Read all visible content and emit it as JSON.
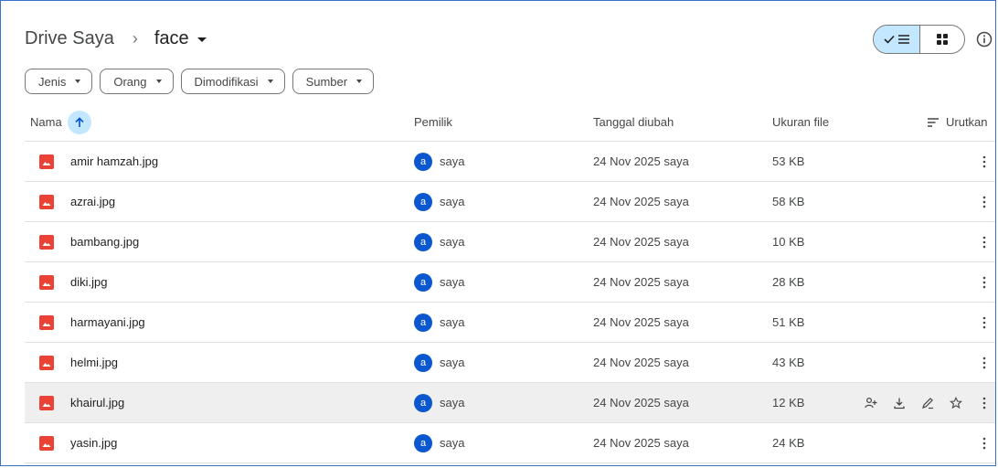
{
  "breadcrumb": {
    "root": "Drive Saya",
    "separator": "›",
    "current": "face"
  },
  "filters": [
    "Jenis",
    "Orang",
    "Dimodifikasi",
    "Sumber"
  ],
  "columns": {
    "name": "Nama",
    "owner": "Pemilik",
    "modified": "Tanggal diubah",
    "size": "Ukuran file",
    "sort": "Urutkan"
  },
  "files": [
    {
      "name": "amir hamzah.jpg",
      "owner_initial": "a",
      "owner": "saya",
      "modified": "24 Nov 2025 saya",
      "size": "53 KB"
    },
    {
      "name": "azrai.jpg",
      "owner_initial": "a",
      "owner": "saya",
      "modified": "24 Nov 2025 saya",
      "size": "58 KB"
    },
    {
      "name": "bambang.jpg",
      "owner_initial": "a",
      "owner": "saya",
      "modified": "24 Nov 2025 saya",
      "size": "10 KB"
    },
    {
      "name": "diki.jpg",
      "owner_initial": "a",
      "owner": "saya",
      "modified": "24 Nov 2025 saya",
      "size": "28 KB"
    },
    {
      "name": "harmayani.jpg",
      "owner_initial": "a",
      "owner": "saya",
      "modified": "24 Nov 2025 saya",
      "size": "51 KB"
    },
    {
      "name": "helmi.jpg",
      "owner_initial": "a",
      "owner": "saya",
      "modified": "24 Nov 2025 saya",
      "size": "43 KB"
    },
    {
      "name": "khairul.jpg",
      "owner_initial": "a",
      "owner": "saya",
      "modified": "24 Nov 2025 saya",
      "size": "12 KB"
    },
    {
      "name": "yasin.jpg",
      "owner_initial": "a",
      "owner": "saya",
      "modified": "24 Nov 2025 saya",
      "size": "24 KB"
    }
  ],
  "hovered_row": 6,
  "row_actions": [
    "share-icon",
    "download-icon",
    "rename-icon",
    "star-icon"
  ],
  "colors": {
    "accent_bg": "#c2e7ff",
    "avatar": "#0b57d0",
    "image_icon": "#ea4335",
    "hover": "#efefef"
  }
}
